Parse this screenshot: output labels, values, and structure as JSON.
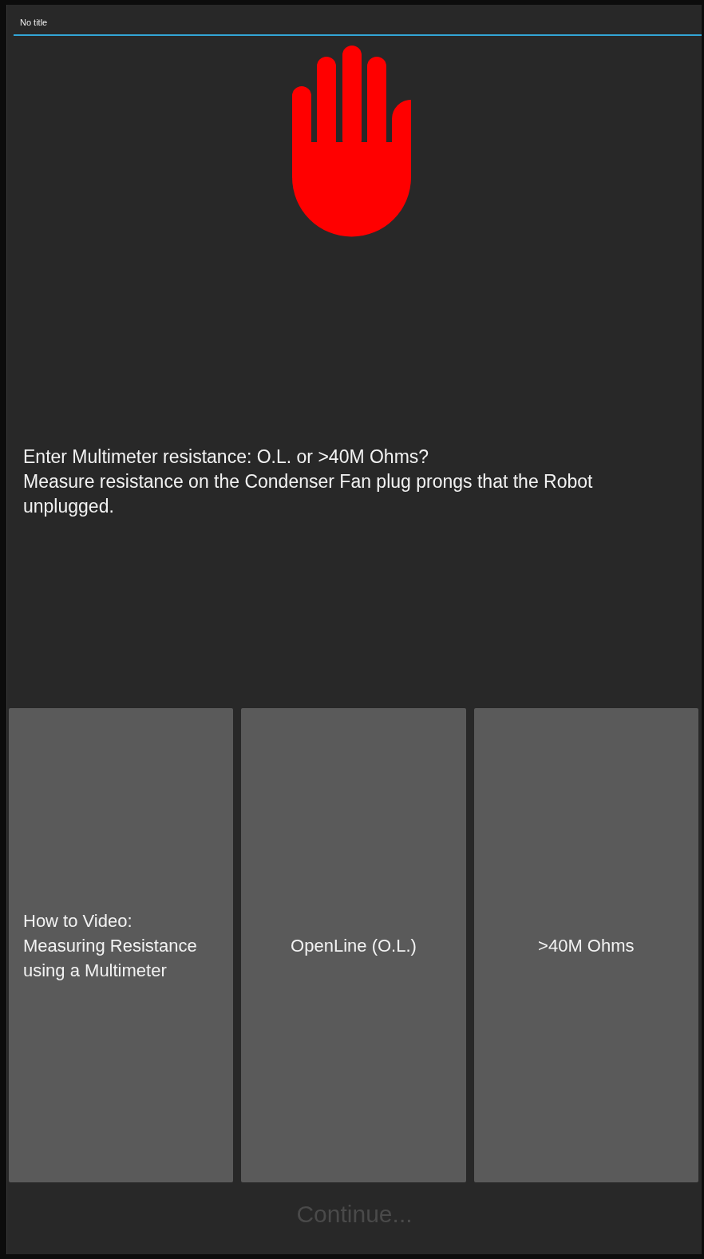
{
  "window": {
    "title": "No title"
  },
  "prompt": [
    "Enter Multimeter resistance: O.L. or >40M Ohms?",
    "Measure resistance on the Condenser Fan plug prongs that the Robot unplugged."
  ],
  "options": [
    {
      "label": "How to Video: Measuring Resistance using a Multimeter",
      "kind": "link"
    },
    {
      "label": "OpenLine (O.L.)",
      "kind": "answer"
    },
    {
      "label": ">40M Ohms",
      "kind": "answer"
    }
  ],
  "continue_button": {
    "label": "Continue...",
    "disabled": true
  }
}
